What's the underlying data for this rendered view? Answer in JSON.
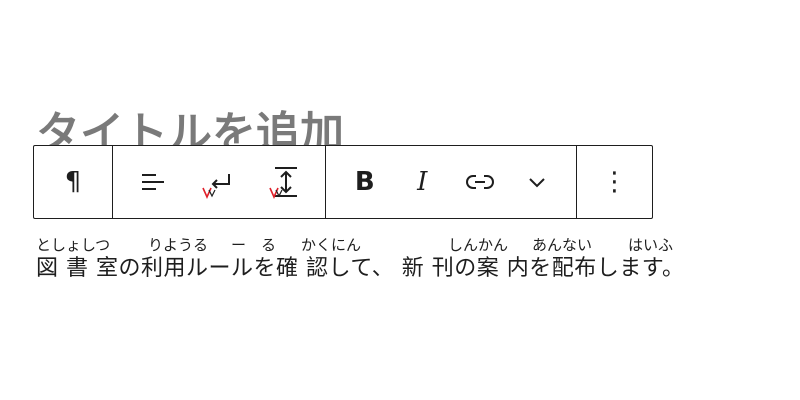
{
  "editor": {
    "title_placeholder": "タイトルを追加",
    "paragraph_text": "図 書 室の利用ルールを確 認して、 新 刊の案 内を配布します。",
    "ruby": [
      {
        "text": "としょしつ"
      },
      {
        "text": "りようる"
      },
      {
        "text": "ー"
      },
      {
        "text": "る"
      },
      {
        "text": "かくにん"
      },
      {
        "text": "しんかん"
      },
      {
        "text": "あんない"
      },
      {
        "text": "はいふ"
      }
    ]
  },
  "toolbar": {
    "paragraph_glyph": "¶",
    "bold_glyph": "B",
    "italic_glyph": "I",
    "more_options_glyph": "⋮"
  },
  "colors": {
    "text": "#1e1e1e",
    "placeholder": "#7a7a7a",
    "badge_red": "#e0202a"
  }
}
